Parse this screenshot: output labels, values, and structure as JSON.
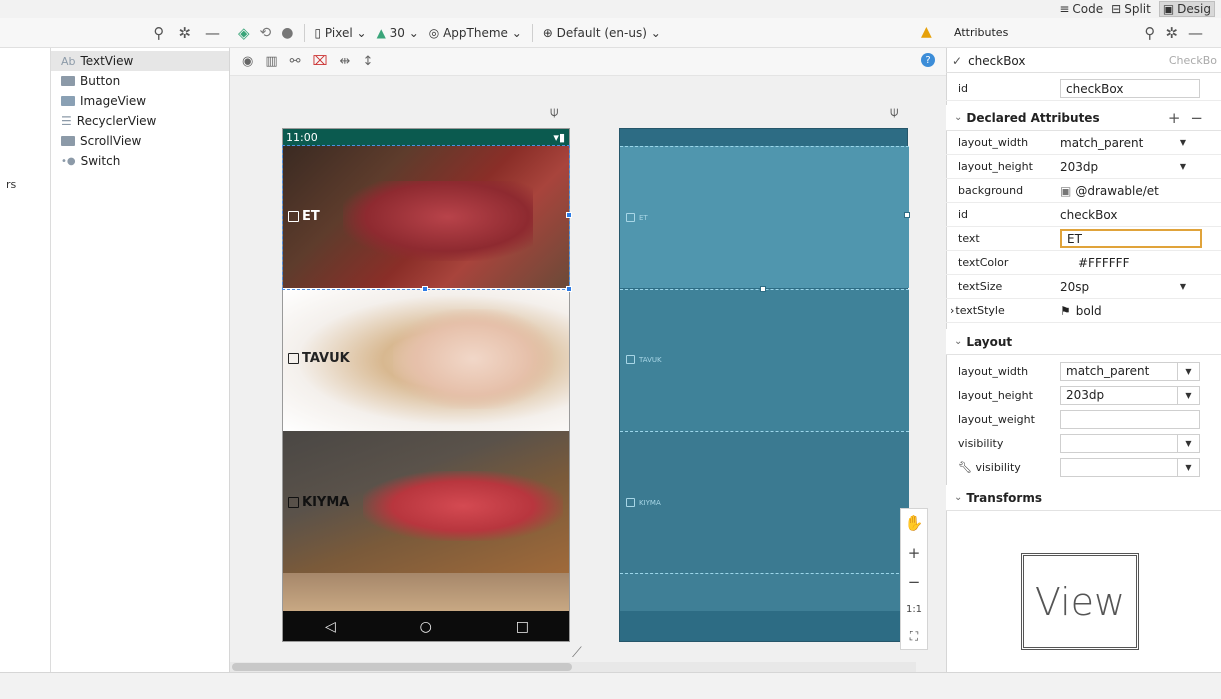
{
  "view_modes": {
    "code": "Code",
    "split": "Split",
    "design": "Desig"
  },
  "palette": {
    "left_stub_1": "",
    "left_stub_2": "rs",
    "items": [
      {
        "label": "TextView",
        "prefix": "Ab",
        "icon": "textview-icon"
      },
      {
        "label": "Button",
        "icon": "button-icon"
      },
      {
        "label": "ImageView",
        "icon": "image-icon"
      },
      {
        "label": "RecyclerView",
        "icon": "list-icon"
      },
      {
        "label": "ScrollView",
        "icon": "scrollview-icon"
      },
      {
        "label": "Switch",
        "icon": "switch-icon"
      }
    ]
  },
  "design_toolbar": {
    "device": "Pixel",
    "api": "30",
    "theme": "AppTheme",
    "locale": "Default (en-us)"
  },
  "phone": {
    "time": "11:00",
    "rows": [
      {
        "label": "ET",
        "bg": "#6e2b25"
      },
      {
        "label": "TAVUK",
        "bg": "#efe9e2"
      },
      {
        "label": "KIYMA",
        "bg": "#5a4a3c"
      }
    ]
  },
  "blueprint": {
    "rows": [
      {
        "label": "ET"
      },
      {
        "label": "TAVUK"
      },
      {
        "label": "KIYMA"
      }
    ]
  },
  "zoom": {
    "one_to_one": "1:1"
  },
  "attributes": {
    "title": "Attributes",
    "component": "checkBox",
    "component_type": "CheckBo",
    "id_label": "id",
    "id_value": "checkBox",
    "declared_title": "Declared Attributes",
    "declared": [
      {
        "key": "layout_width",
        "value": "match_parent",
        "dd": true
      },
      {
        "key": "layout_height",
        "value": "203dp",
        "dd": true
      },
      {
        "key": "background",
        "value": "@drawable/et"
      },
      {
        "key": "id",
        "value": "checkBox"
      },
      {
        "key": "text",
        "value": "ET"
      },
      {
        "key": "textColor",
        "value": "#FFFFFF"
      },
      {
        "key": "textSize",
        "value": "20sp",
        "dd": true
      },
      {
        "key": "textStyle",
        "value": "bold"
      }
    ],
    "layout_title": "Layout",
    "layout": [
      {
        "key": "layout_width",
        "value": "match_parent"
      },
      {
        "key": "layout_height",
        "value": "203dp"
      },
      {
        "key": "layout_weight",
        "value": ""
      },
      {
        "key": "visibility",
        "value": ""
      },
      {
        "key": "visibility",
        "value": ""
      }
    ],
    "transforms_title": "Transforms",
    "view_label": "View"
  },
  "colors": {
    "accent": "#2c7be5",
    "status": "#0b5a4f",
    "blueprint": "#2d6c84",
    "warning": "#e6a10a"
  }
}
